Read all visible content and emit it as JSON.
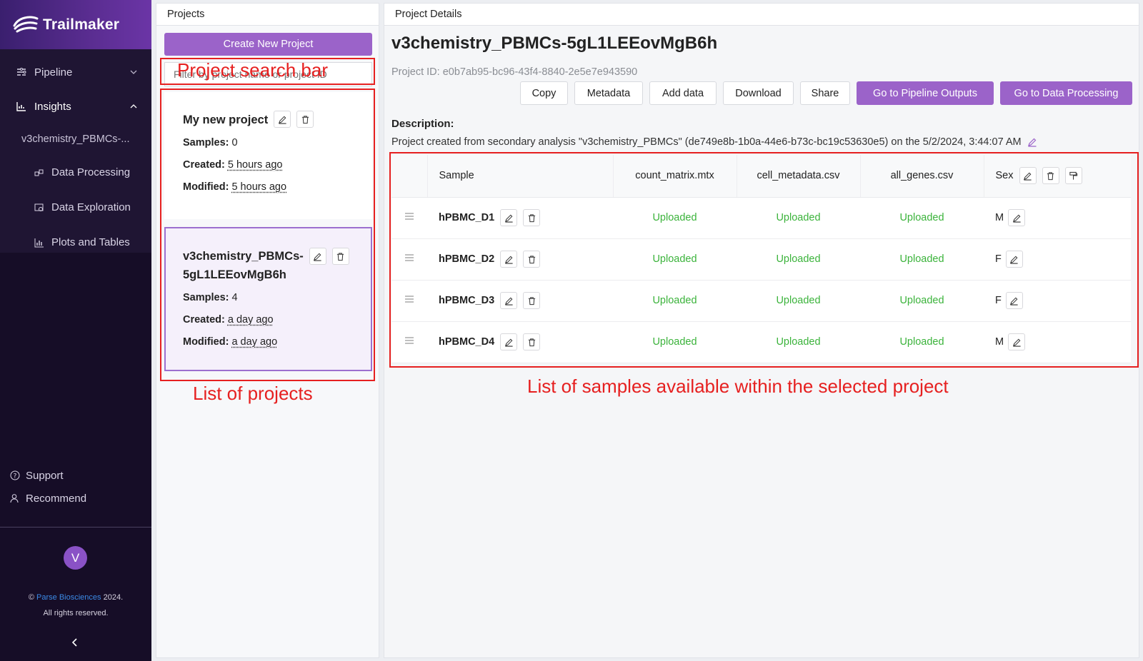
{
  "app": {
    "name": "Trailmaker"
  },
  "sidebar": {
    "menu": [
      {
        "label": "Pipeline"
      },
      {
        "label": "Insights"
      }
    ],
    "current_project": "v3chemistry_PBMCs-...",
    "insights_items": [
      {
        "label": "Data Processing"
      },
      {
        "label": "Data Exploration"
      },
      {
        "label": "Plots and Tables"
      }
    ],
    "support_label": "Support",
    "recommend_label": "Recommend",
    "avatar_initial": "V",
    "copyright_prefix": "©",
    "copyright_brand": "Parse Biosciences",
    "copyright_year": "2024.",
    "copyright_rights": "All rights reserved."
  },
  "projects_panel": {
    "title": "Projects",
    "create_button": "Create New Project",
    "search_placeholder": "Filter by project name or project ID",
    "projects": [
      {
        "name": "My new project",
        "samples_label": "Samples",
        "samples": "0",
        "created_label": "Created",
        "created": "5 hours ago",
        "modified_label": "Modified",
        "modified": "5 hours ago"
      },
      {
        "name_line1": "v3chemistry_PBMCs-",
        "name_line2": "5gL1LEEovMgB6h",
        "samples_label": "Samples",
        "samples": "4",
        "created_label": "Created",
        "created": "a day ago",
        "modified_label": "Modified",
        "modified": "a day ago"
      }
    ]
  },
  "details": {
    "title": "Project Details",
    "project_name": "v3chemistry_PBMCs-5gL1LEEovMgB6h",
    "project_id": "Project ID: e0b7ab95-bc96-43f4-8840-2e5e7e943590",
    "actions": [
      "Copy",
      "Metadata",
      "Add data",
      "Download",
      "Share",
      "Go to Pipeline Outputs",
      "Go to Data Processing"
    ],
    "description_label": "Description:",
    "description": "Project created from secondary analysis \"v3chemistry_PBMCs\" (de749e8b-1b0a-44e6-b73c-bc19c53630e5) on the 5/2/2024, 3:44:07 AM",
    "table": {
      "headers": [
        "Sample",
        "count_matrix.mtx",
        "cell_metadata.csv",
        "all_genes.csv",
        "Sex"
      ],
      "rows": [
        {
          "sample": "hPBMC_D1",
          "count": "Uploaded",
          "meta": "Uploaded",
          "genes": "Uploaded",
          "sex": "M"
        },
        {
          "sample": "hPBMC_D2",
          "count": "Uploaded",
          "meta": "Uploaded",
          "genes": "Uploaded",
          "sex": "F"
        },
        {
          "sample": "hPBMC_D3",
          "count": "Uploaded",
          "meta": "Uploaded",
          "genes": "Uploaded",
          "sex": "F"
        },
        {
          "sample": "hPBMC_D4",
          "count": "Uploaded",
          "meta": "Uploaded",
          "genes": "Uploaded",
          "sex": "M"
        }
      ]
    }
  },
  "annotations": {
    "search_bar": "Project search bar",
    "list_projects": "List of projects",
    "list_samples": "List of samples available within the selected project"
  },
  "colors": {
    "accent": "#9b63c9",
    "annotation": "#e62020",
    "status_uploaded": "#3bb33b",
    "sidebar_bg": "#160d27"
  }
}
